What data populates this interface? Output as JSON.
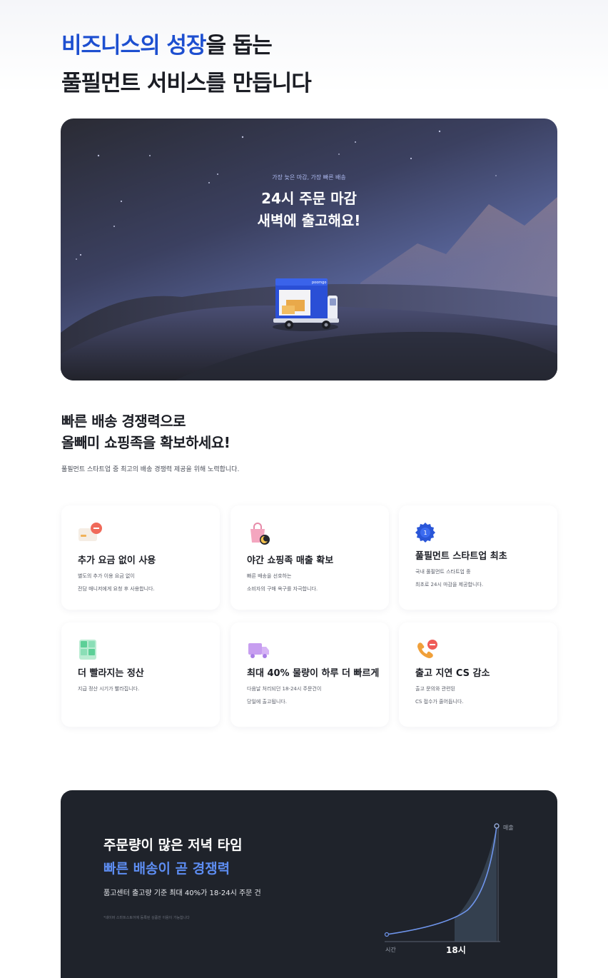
{
  "headline": {
    "accent": "비즈니스의 성장",
    "rest1": "을 돕는",
    "line2": "풀필먼트 서비스를 만듭니다"
  },
  "hero": {
    "kicker": "가장 늦은 마감, 가장 빠른 배송",
    "title_line1": "24시 주문 마감",
    "title_line2": "새벽에 출고해요!",
    "truck_brand": "poomgo"
  },
  "section": {
    "title_line1": "빠른 배송 경쟁력으로",
    "title_line2": "올빼미 쇼핑족을 확보하세요!",
    "desc": "풀필먼트 스타트업 중 최고의 배송 경쟁력 제공을 위해 노력합니다."
  },
  "cards": [
    {
      "icon": "card-fee-icon",
      "title": "추가 요금 없이 사용",
      "desc1": "별도의 추가 이용 요금 없이",
      "desc2": "전담 매니저에게 요청 후 사용합니다."
    },
    {
      "icon": "shopping-bag-moon-icon",
      "title": "야간 쇼핑족 매출 확보",
      "desc1": "빠른 배송을 선호하는",
      "desc2": "소비자의 구매 욕구를 자극합니다."
    },
    {
      "icon": "first-badge-icon",
      "badge": "1",
      "title": "풀필먼트 스타트업 최초",
      "desc1": "국내 풀필먼트 스타트업 중",
      "desc2": "최초로 24시 마감을 제공합니다."
    },
    {
      "icon": "calculator-icon",
      "title": "더 빨라지는 정산",
      "desc1": "지급 정산 시기가 빨라집니다.",
      "desc2": ""
    },
    {
      "icon": "truck-icon",
      "title": "최대 40% 물량이 하루 더 빠르게",
      "desc1": "다음날 처리되던 18-24시 주문건이",
      "desc2": "당일에 출고됩니다."
    },
    {
      "icon": "phone-call-icon",
      "title": "출고 지연 CS 감소",
      "desc1": "출고 문의와 관련된",
      "desc2": "CS 접수가 줄어듭니다."
    }
  ],
  "dark_section": {
    "line1": "주문량이 많은 저녁 타임",
    "line2": "빠른 배송이 곧 경쟁력",
    "line3": "품고센터 출고량 기준  최대 40%가 18-24시 주문 건",
    "footnote": "*네이버 스마트스토어에 등록된 상품만 이용이 가능합니다",
    "chart": {
      "y_label": "매출",
      "x_label": "시간",
      "highlight_label": "18시",
      "line_color": "#6f95ec",
      "area_color": "#34404f"
    }
  },
  "colors": {
    "accent": "#1d4fd0",
    "hero_blue": "#2a4fd6",
    "dark_bg": "#1f232b",
    "chart_accent": "#5d8df2"
  }
}
